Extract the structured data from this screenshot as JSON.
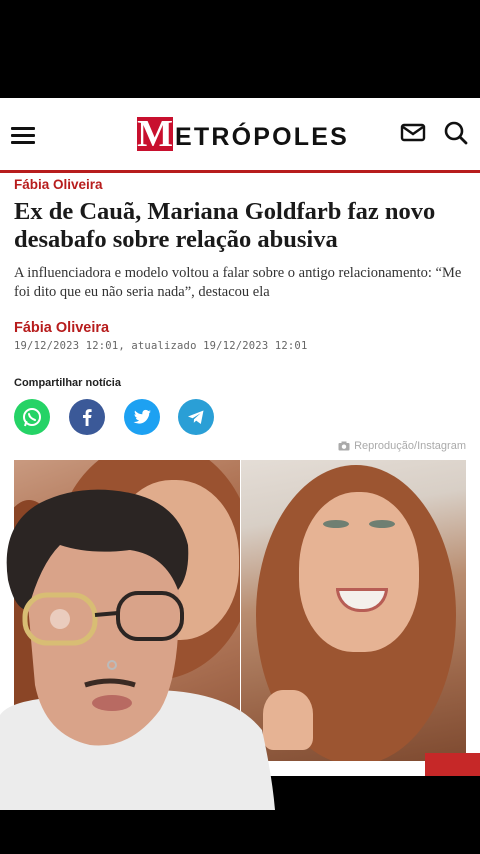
{
  "header": {
    "logo_initial": "M",
    "logo_rest": "ETRÓPOLES",
    "menu_icon": "hamburger-menu-icon",
    "mail_icon": "mail-icon",
    "search_icon": "search-icon"
  },
  "article": {
    "section_author": "Fábia Oliveira",
    "headline": "Ex de Cauã, Mariana Goldfarb faz novo desabafo sobre relação abusiva",
    "lead": "A influenciadora e modelo voltou a falar sobre o antigo relacionamento: “Me foi dito que eu não seria nada”, destacou ela",
    "author": "Fábia Oliveira",
    "dates": "19/12/2023 12:01, atualizado 19/12/2023 12:01",
    "share_label": "Compartilhar notícia",
    "share_icons": [
      "whatsapp-icon",
      "facebook-icon",
      "twitter-icon",
      "telegram-icon"
    ],
    "photo_credit": "Reprodução/Instagram"
  },
  "colors": {
    "brand_red": "#c8102e",
    "whatsapp": "#25d366",
    "facebook": "#3b5998",
    "twitter": "#1da1f2",
    "telegram": "#2a9fd6"
  }
}
